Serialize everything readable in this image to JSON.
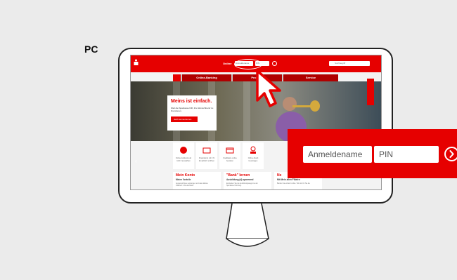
{
  "label": {
    "device": "PC"
  },
  "header": {
    "online_text": "Online",
    "username_placeholder": "Anmeldename",
    "pin_placeholder": "PIN",
    "search_placeholder": "Suchbegriff"
  },
  "nav": {
    "items": [
      "Online-Banking",
      "Produkte",
      "Service"
    ]
  },
  "hero": {
    "title": "Meins ist einfach.",
    "text": "Weil die Sparkasse hilft, ihre Wunschberuf zu finanzieren.",
    "button": "Jetzt kennenlernen"
  },
  "tiles": [
    {
      "icon": "card-icon",
      "text": "Online-Girokonto ab 0,00 € auswählen"
    },
    {
      "icon": "piggy-icon",
      "text": "Kinderkonto mit 0 % Ein jährlich eröffnen"
    },
    {
      "icon": "credit-card-icon",
      "text": "Kreditkarte online bestellen"
    },
    {
      "icon": "person-icon",
      "text": "Online-Kredit beantragen"
    }
  ],
  "cards": [
    {
      "title": "Mein Konto",
      "subtitle": "Meine Vorteile",
      "text": "Ausgezeichnete Leistungen und das stärkste Filialnetz in Deutschland."
    },
    {
      "title": "\"Bank\" lernen",
      "subtitle": "Ausbildung (d) spannend",
      "text": "Entdecken Sie die Ausbildungswege bei der Sparkasse Nürnberg."
    },
    {
      "title": "Ne",
      "subtitle": "Mit Mein allen Filialen",
      "text": "Bleiben Sie einfach online. Wir sind für Sie da."
    }
  ],
  "zoom": {
    "username_placeholder": "Anmeldename",
    "pin_placeholder": "PIN"
  },
  "colors": {
    "brand_red": "#e60000",
    "background": "#ebebeb"
  }
}
